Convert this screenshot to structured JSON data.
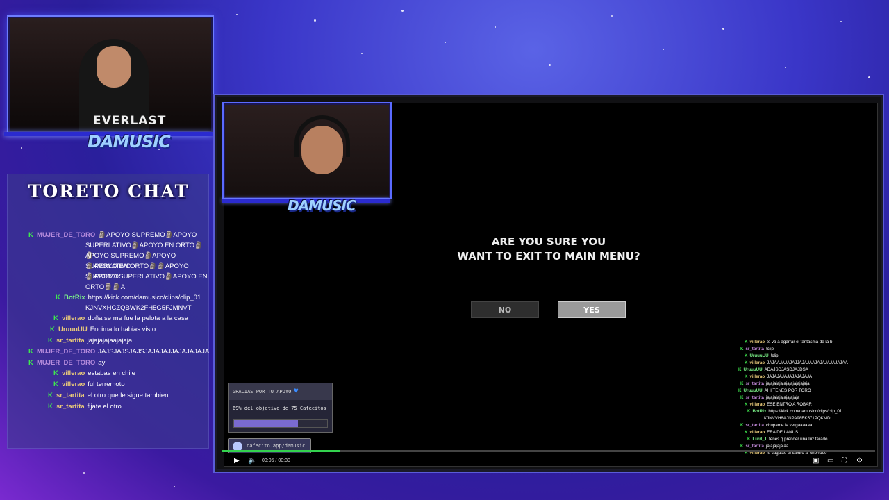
{
  "chat_panel": {
    "title": "TORETO CHAT",
    "messages": [
      {
        "user": "MUJER_DE_TORO",
        "lines": [
          "🗿APOYO SUPREMO🗿APOYO",
          "SUPERLATIVO🗿APOYO EN ORTO🗿🗿",
          "APOYO SUPREMO🗿APOYO SUPERLATIVO",
          "🗿APOYO EN ORTO🗿🗿APOYO SUPREMO",
          "🗿APOYO SUPERLATIVO🗿APOYO EN",
          "ORTO🗿🗿A"
        ]
      },
      {
        "user": "BotRix",
        "lines": [
          "https://kick.com/damusicc/clips/clip_01",
          "KJNVXHCZQBWK2FH5G5FJMNVT"
        ]
      },
      {
        "user": "villerao",
        "lines": [
          "doña se me fue la pelota a la casa"
        ]
      },
      {
        "user": "UruuuUU",
        "lines": [
          "Encima lo habias visto"
        ]
      },
      {
        "user": "sr_tartita",
        "lines": [
          "jajajajajaajajaja"
        ]
      },
      {
        "user": "MUJER_DE_TORO",
        "lines": [
          "JAJSJAJSJAJSJAJAJAJJAJAJAJAJA"
        ]
      },
      {
        "user": "MUJER_DE_TORO",
        "lines": [
          "ay"
        ]
      },
      {
        "user": "villerao",
        "lines": [
          "estabas en chile"
        ]
      },
      {
        "user": "villerao",
        "lines": [
          "ful terremoto"
        ]
      },
      {
        "user": "sr_tartita",
        "lines": [
          "el otro que le sigue tambien"
        ]
      },
      {
        "user": "sr_tartita",
        "lines": [
          "fijate el otro"
        ]
      }
    ]
  },
  "webcam": {
    "shirt_text": "EVERLAST",
    "logo_text": "DAMUSIC"
  },
  "dialog": {
    "question_line1": "ARE YOU SURE YOU",
    "question_line2": "WANT TO EXIT TO MAIN MENU?",
    "no_label": "NO",
    "yes_label": "YES"
  },
  "donation": {
    "header": "GRACIAS POR TU APOYO",
    "goal_text": "69% del objetivo de 75 Cafecitos",
    "progress_fraction": 0.69,
    "link_text": "cafecito.app/damusic"
  },
  "overlay_chat": [
    {
      "user": "villerao",
      "text": "te va a agarrar el fantasma de la b"
    },
    {
      "user": "sr_tartita",
      "text": "!clip"
    },
    {
      "user": "UruuuUU",
      "text": "!clip"
    },
    {
      "user": "villerao",
      "text": "JAJAAJAJAJAJJAJAJAAJAJAJAJAJAJAA"
    },
    {
      "user": "UruuuUU",
      "text": "ADAJSDJASDJAJDSA"
    },
    {
      "user": "villerao",
      "text": "JAJAJAJAJAJAJAJAJA"
    },
    {
      "user": "sr_tartita",
      "text": "jajajajajajajajajajajajaja"
    },
    {
      "user": "UruuuUU",
      "text": "AHI TENES POR TORO"
    },
    {
      "user": "sr_tartita",
      "text": "jajajajajajajajajaja"
    },
    {
      "user": "villerao",
      "text": "ESE ENTRO A ROBAR"
    },
    {
      "user": "BotRix",
      "text": "https://kick.com/damusicc/clips/clip_01"
    },
    {
      "user": "",
      "text": "KJNVVH8AJNPA98EK571PQKMD"
    },
    {
      "user": "sr_tartita",
      "text": "chupame la vergaaaaaa"
    },
    {
      "user": "villerao",
      "text": "ERA DE LANUS"
    },
    {
      "user": "Lurd_1",
      "text": "tenes q prender una luz tarado"
    },
    {
      "user": "sr_tartita",
      "text": "jajajajajajaa"
    },
    {
      "user": "villerao",
      "text": "le cagaste el laburo al chorrooo"
    }
  ],
  "player": {
    "time": "00:05 / 00:30",
    "progress_fraction": 0.18
  },
  "icons": {
    "play": "play-icon",
    "volume": "volume-icon",
    "pip": "pip-icon",
    "theater": "theater-icon",
    "fullscreen": "fullscreen-icon",
    "settings": "settings-icon"
  },
  "colors": {
    "kick_green": "#3ee84e",
    "accent_blue": "#5a6aff"
  }
}
